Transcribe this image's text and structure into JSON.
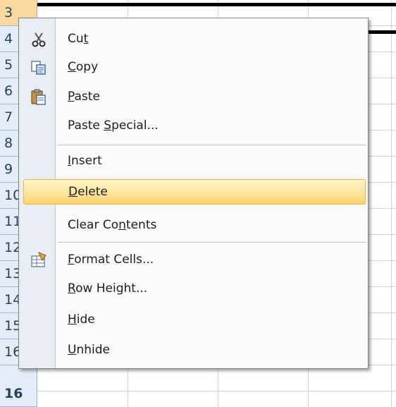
{
  "sheet": {
    "row_headers": [
      {
        "label": "3",
        "selected": true
      },
      {
        "label": "4"
      },
      {
        "label": "5"
      },
      {
        "label": "6"
      },
      {
        "label": "7"
      },
      {
        "label": "8"
      },
      {
        "label": "9"
      },
      {
        "label": "10"
      },
      {
        "label": "11"
      },
      {
        "label": "12"
      },
      {
        "label": "13"
      },
      {
        "label": "14"
      },
      {
        "label": "15"
      },
      {
        "label": "16"
      }
    ],
    "colors": {
      "header_bg": "#e4ecf7",
      "grid": "#d0d7e5",
      "selected_header": "#f9d99f"
    }
  },
  "context_menu": {
    "items": [
      {
        "pre": "Cu",
        "key": "t",
        "post": "",
        "icon": "scissors-icon"
      },
      {
        "pre": "",
        "key": "C",
        "post": "opy",
        "icon": "copy-icon"
      },
      {
        "pre": "",
        "key": "P",
        "post": "aste",
        "icon": "paste-icon"
      },
      {
        "pre": "Paste ",
        "key": "S",
        "post": "pecial...",
        "icon": ""
      },
      {
        "pre": "",
        "key": "I",
        "post": "nsert",
        "icon": ""
      },
      {
        "pre": "",
        "key": "D",
        "post": "elete",
        "icon": "",
        "highlighted": true
      },
      {
        "pre": "Clear Co",
        "key": "n",
        "post": "tents",
        "icon": ""
      },
      {
        "pre": "",
        "key": "F",
        "post": "ormat Cells...",
        "icon": "format-cells-icon"
      },
      {
        "pre": "",
        "key": "R",
        "post": "ow Height...",
        "icon": ""
      },
      {
        "pre": "",
        "key": "H",
        "post": "ide",
        "icon": ""
      },
      {
        "pre": "",
        "key": "U",
        "post": "nhide",
        "icon": ""
      }
    ],
    "highlight_color": "#fbd26d"
  }
}
